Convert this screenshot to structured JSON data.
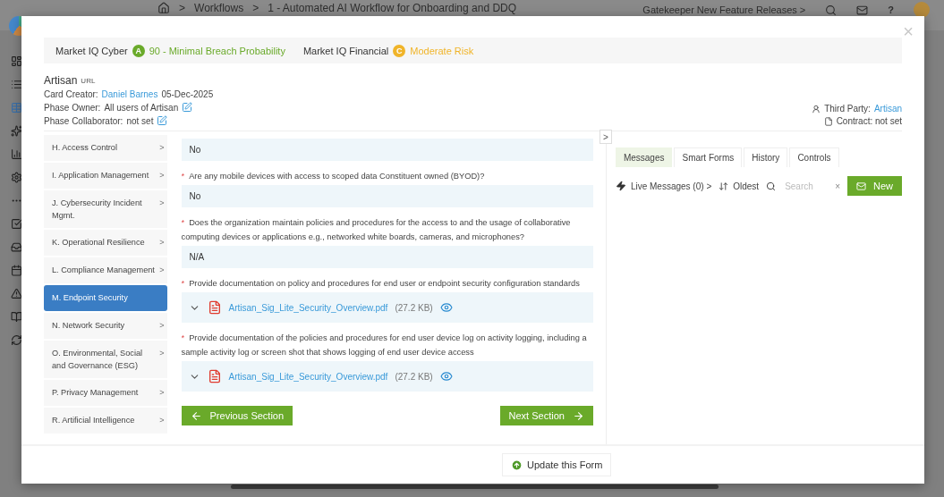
{
  "app_bar": {
    "breadcrumbs": [
      "Workflows",
      "1 - Automated AI Workflow for Onboarding and DDQ"
    ],
    "separator": ">",
    "releases": "Gatekeeper New Feature Releases",
    "releases_caret": ">",
    "help": "?"
  },
  "modal": {
    "close": "×",
    "scores": [
      {
        "label": "Market IQ Cyber",
        "grade": "A",
        "text": "90 - Minimal Breach Probability",
        "color": "#6aaa2a"
      },
      {
        "label": "Market IQ Financial",
        "grade": "C",
        "text": "Moderate Risk",
        "color": "#f0b429"
      }
    ],
    "card": {
      "title": "Artisan",
      "title_tag": "URL",
      "creator_label": "Card Creator:",
      "creator": "Daniel Barnes",
      "created": "05-Dec-2025",
      "owner_label": "Phase Owner:",
      "owner": "All users of Artisan",
      "collaborator_label": "Phase Collaborator:",
      "collaborator": "not set",
      "third_party_label": "Third Party:",
      "third_party": "Artisan",
      "contract": "Contract: not set"
    },
    "sections": [
      {
        "label": "H. Access Control",
        "selected": false
      },
      {
        "label": "I. Application Management",
        "selected": false
      },
      {
        "label": "J. Cybersecurity Incident Mgmt.",
        "selected": false
      },
      {
        "label": "K. Operational Resilience",
        "selected": false
      },
      {
        "label": "L. Compliance Management",
        "selected": false
      },
      {
        "label": "M. Endpoint Security",
        "selected": true
      },
      {
        "label": "N. Network Security",
        "selected": false
      },
      {
        "label": "O. Environmental, Social and Governance (ESG)",
        "selected": false
      },
      {
        "label": "P. Privacy Management",
        "selected": false
      },
      {
        "label": "R. Artificial Intelligence",
        "selected": false
      }
    ],
    "section_caret": ">",
    "fields": [
      {
        "kind": "text",
        "value": "No"
      },
      {
        "kind": "text",
        "required": true,
        "question": "Are any mobile devices with access to scoped data Constituent owned (BYOD)?",
        "value": "No"
      },
      {
        "kind": "text",
        "required": true,
        "question": "Does the organization maintain policies and procedures for the access to and the usage of collaborative computing devices or applications e.g., networked white boards, cameras, and microphones?",
        "value": "N/A"
      },
      {
        "kind": "file",
        "required": true,
        "question": "Provide documentation on policy and procedures for end user or endpoint security configuration standards",
        "file_name": "Artisan_Sig_Lite_Security_Overview.pdf",
        "file_size": "(27.2 KB)"
      },
      {
        "kind": "file",
        "required": true,
        "question": "Provide documentation of the policies and procedures for end user device log on activity logging, including a sample activity log or screen shot that shows logging of end user device access",
        "file_name": "Artisan_Sig_Lite_Security_Overview.pdf",
        "file_size": "(27.2 KB)"
      }
    ],
    "required_mark": "*",
    "previous_button": "Previous Section",
    "next_button": "Next Section",
    "update_button": "Update this Form",
    "panel_toggle": ">",
    "tabs": [
      {
        "label": "Messages",
        "selected": true
      },
      {
        "label": "Smart Forms",
        "selected": false
      },
      {
        "label": "History",
        "selected": false
      },
      {
        "label": "Controls",
        "selected": false
      }
    ],
    "toolbar": {
      "live": "Live Messages (0)",
      "live_caret": ">",
      "sort": "Oldest",
      "search_placeholder": "Search",
      "clear": "×",
      "new_button": "New"
    }
  }
}
